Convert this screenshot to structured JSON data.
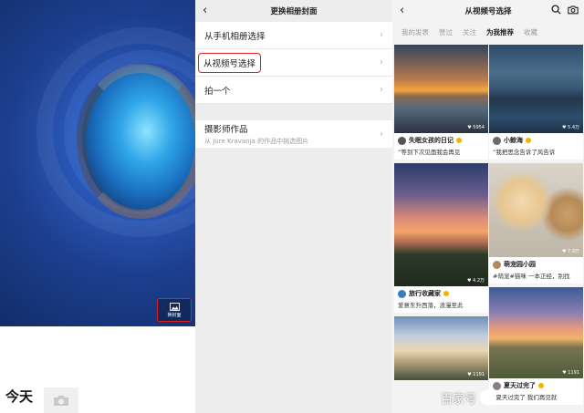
{
  "album": {
    "change_cover_label": "换封面",
    "today_label": "今天"
  },
  "cover_menu": {
    "title": "更换相册封面",
    "items": [
      {
        "label": "从手机相册选择"
      },
      {
        "label": "从视频号选择"
      },
      {
        "label": "拍一个"
      }
    ],
    "photographer": {
      "label": "摄影师作品",
      "sub": "从 Jure Kravanja 的作品中挑选图片"
    }
  },
  "video_picker": {
    "title": "从视频号选择",
    "tabs": [
      "我的发表",
      "赞过",
      "关注",
      "为我推荐",
      "收藏"
    ],
    "active_tab": "为我推荐",
    "left_column": [
      {
        "likes": "5954",
        "author": "失眠女孩的日记",
        "desc": "“等到下次见面我会再见"
      },
      {
        "likes": "4.2万",
        "author": "旅行收藏家",
        "desc": "爱意东升西落，浪漫至此"
      },
      {
        "likes": "1191",
        "author": "",
        "desc": ""
      }
    ],
    "right_column": [
      {
        "likes": "5.4万",
        "author": "小鲸海",
        "desc": "“我把思念告诉了风告诉"
      },
      {
        "likes": "7.9万",
        "author": "萌宠园小园",
        "desc": "#萌宠#猫咪 一本正经，别找"
      },
      {
        "likes": "1191",
        "author": "夏天过完了",
        "desc": "“夏天过完了 我们再见就"
      }
    ]
  },
  "watermark": "百家号"
}
